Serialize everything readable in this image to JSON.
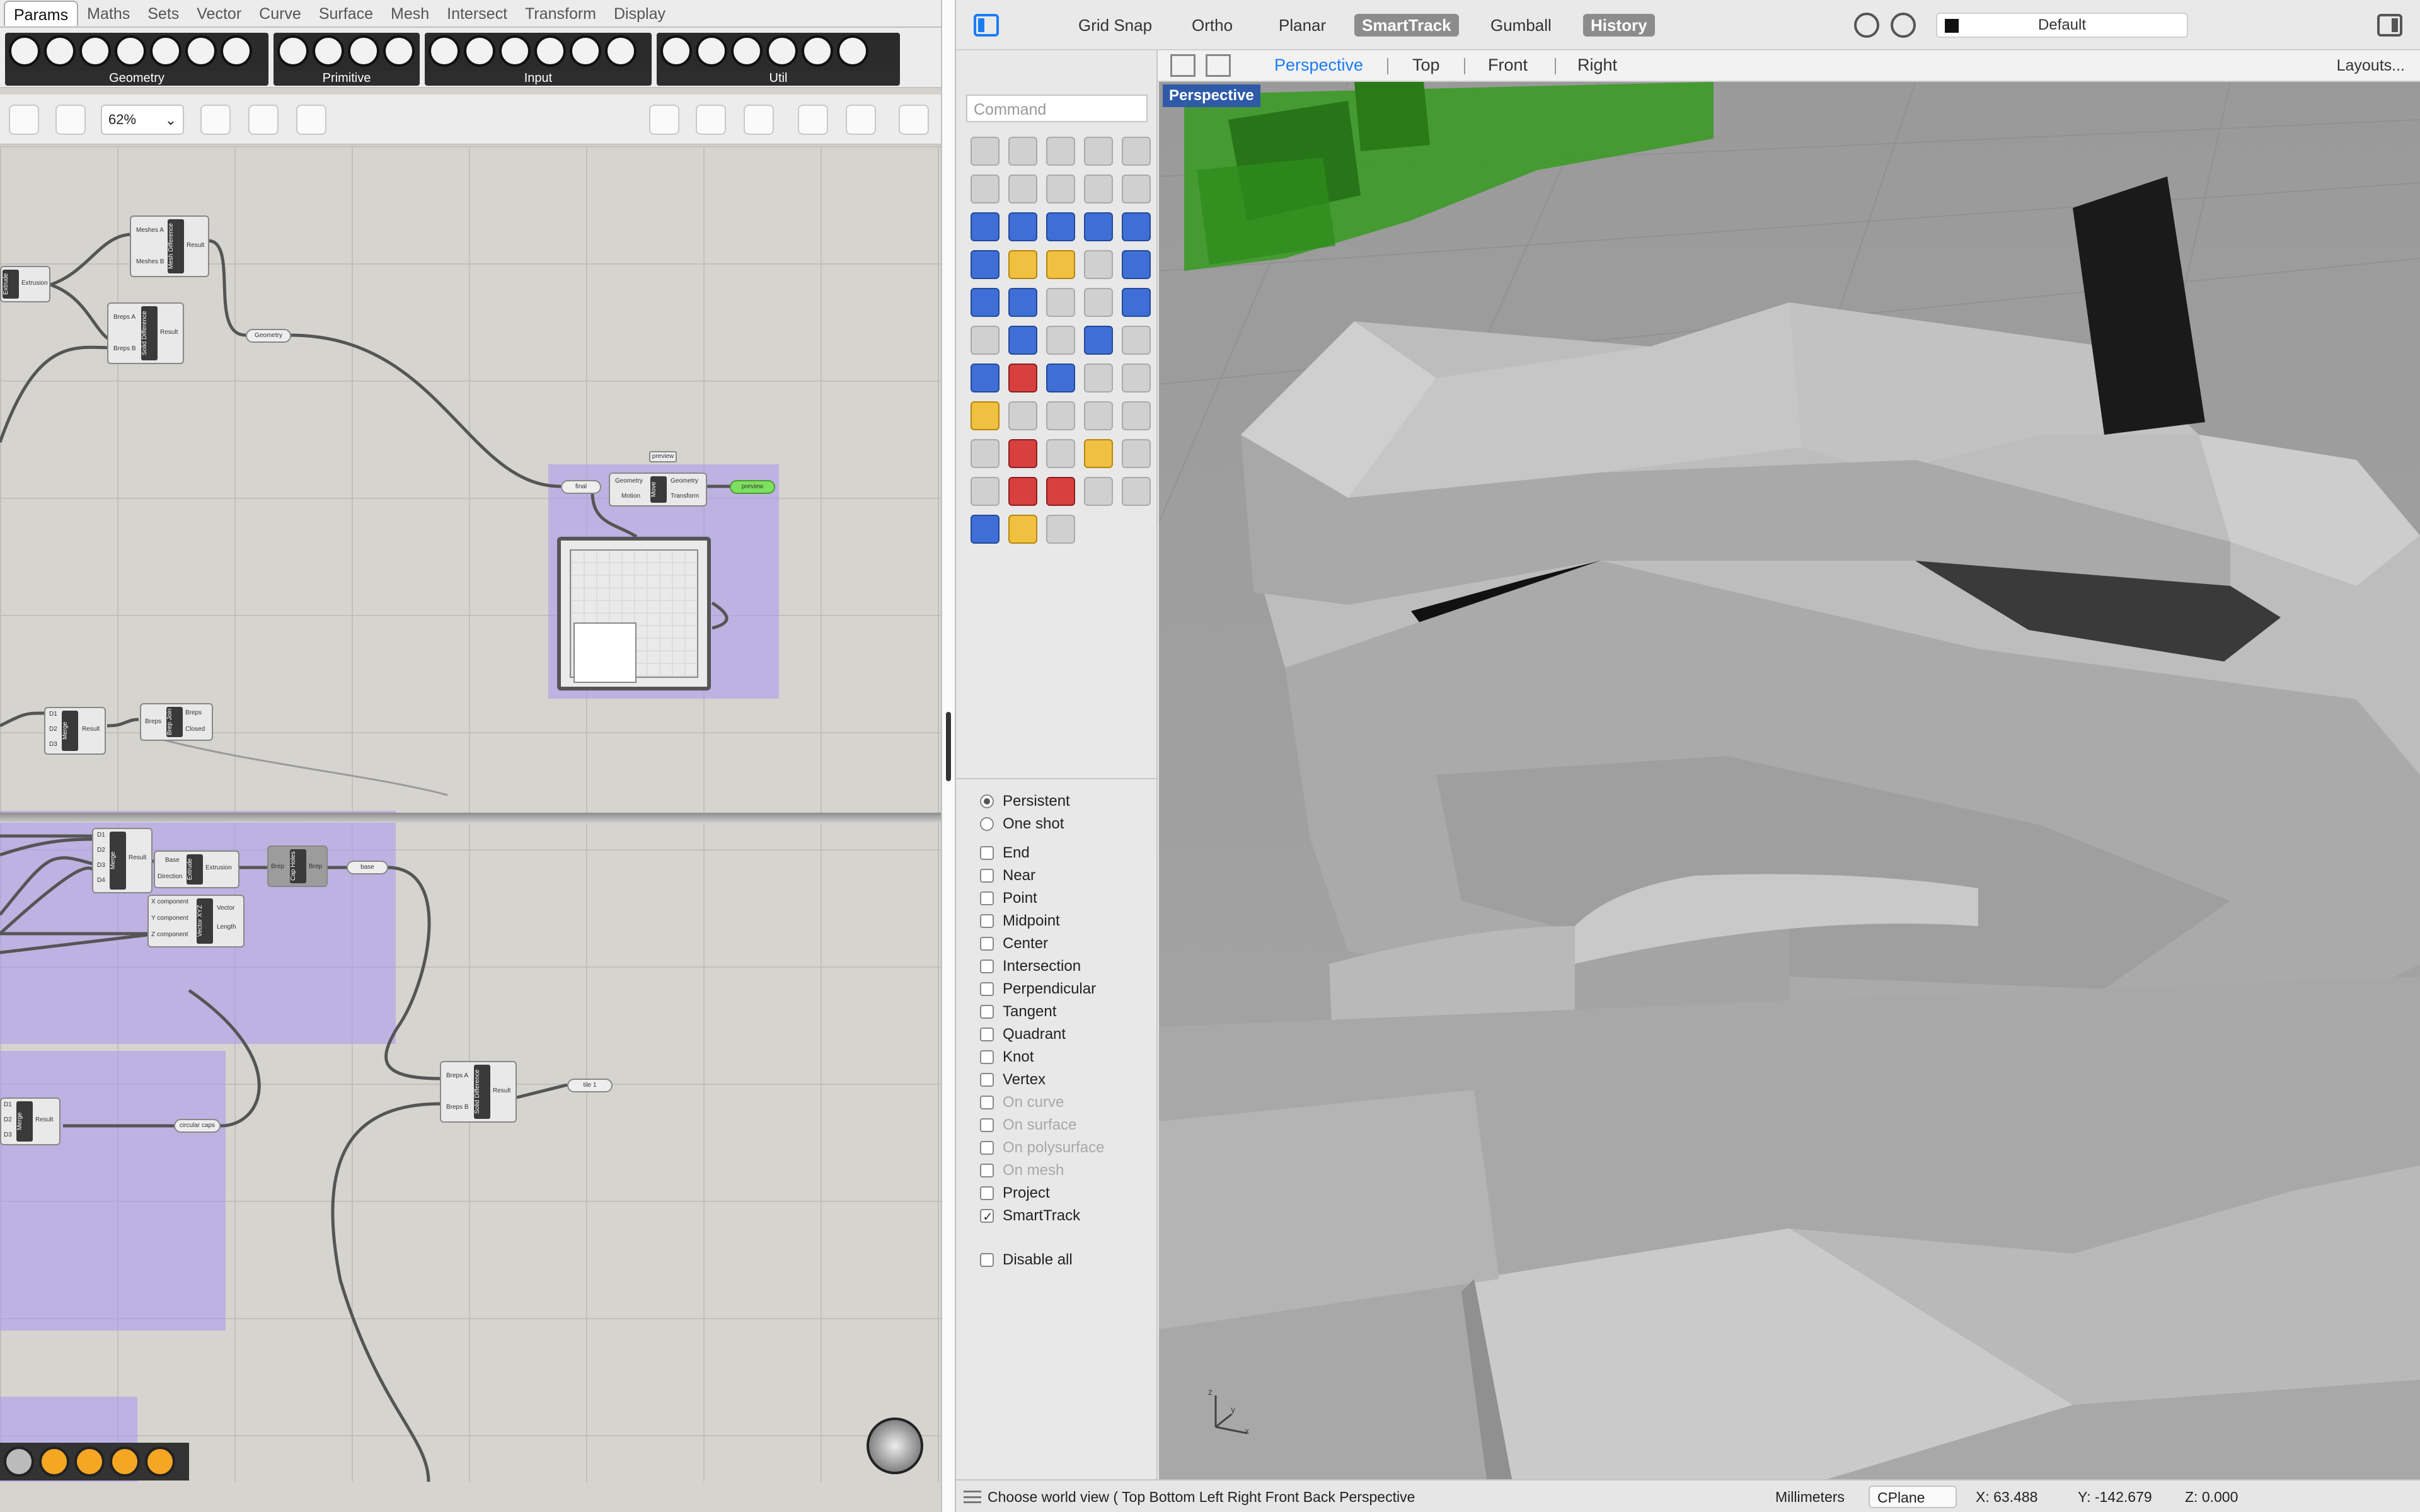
{
  "grasshopper": {
    "tabs": [
      "Params",
      "Maths",
      "Sets",
      "Vector",
      "Curve",
      "Surface",
      "Mesh",
      "Intersect",
      "Transform",
      "Display"
    ],
    "active_tab": "Params",
    "ribbon_groups": [
      "Geometry",
      "Primitive",
      "Input",
      "Util"
    ],
    "zoom": "62%",
    "nodes": {
      "mesh_difference": {
        "title": "Mesh Difference",
        "in1": "Meshes A",
        "in2": "Meshes B",
        "out": "Result"
      },
      "solid_difference_top": {
        "title": "Solid Difference",
        "in1": "Breps A",
        "in2": "Breps B",
        "out": "Result"
      },
      "extrude_left": {
        "title": "Extrude",
        "out": "Extrusion"
      },
      "geometry_param": "Geometry",
      "preview_label": "preview",
      "final_param": "final",
      "move": {
        "title": "Move",
        "in1": "Geometry",
        "in2": "Motion",
        "out1": "Geometry",
        "out2": "Transform"
      },
      "preview_param": "preview",
      "merge_top": {
        "title": "Merge",
        "in": [
          "D1",
          "D2",
          "D3"
        ],
        "out": "Result"
      },
      "brep_join": {
        "title": "Brep Join",
        "in": "Breps",
        "out1": "Breps",
        "out2": "Closed"
      },
      "merge_mid": {
        "title": "Merge",
        "in": [
          "D1",
          "D2",
          "D3",
          "D4"
        ],
        "out": "Result"
      },
      "extrude_mid": {
        "title": "Extrude",
        "in1": "Base",
        "in2": "Direction",
        "out": "Extrusion"
      },
      "cap_holes": {
        "title": "Cap Holes",
        "in": "Brep",
        "out": "Brep"
      },
      "base_param": "base",
      "vector_xyz": {
        "title": "Vector XYZ",
        "in": [
          "X component",
          "Y component",
          "Z component"
        ],
        "out1": "Vector",
        "out2": "Length"
      },
      "solid_difference_bottom": {
        "title": "Solid Difference",
        "in1": "Breps A",
        "in2": "Breps B",
        "out": "Result"
      },
      "tile_param": "tile 1",
      "merge_bottom": {
        "title": "Merge",
        "in": [
          "D1",
          "D2",
          "D3"
        ],
        "out": "Result"
      },
      "circular_caps_param": "circular caps"
    }
  },
  "rhino": {
    "modes": [
      {
        "label": "Grid Snap",
        "on": false
      },
      {
        "label": "Ortho",
        "on": false
      },
      {
        "label": "Planar",
        "on": false
      },
      {
        "label": "SmartTrack",
        "on": true
      },
      {
        "label": "Gumball",
        "on": false
      },
      {
        "label": "History",
        "on": true
      }
    ],
    "layer": "Default",
    "view_tabs": [
      "Perspective",
      "Top",
      "Front",
      "Right"
    ],
    "active_view": "Perspective",
    "layouts_label": "Layouts...",
    "command_placeholder": "Command",
    "viewport_label": "Perspective",
    "snap_mode": [
      {
        "label": "Persistent",
        "checked": true
      },
      {
        "label": "One shot",
        "checked": false
      }
    ],
    "osnaps": [
      {
        "label": "End",
        "checked": false,
        "enabled": true
      },
      {
        "label": "Near",
        "checked": false,
        "enabled": true
      },
      {
        "label": "Point",
        "checked": false,
        "enabled": true
      },
      {
        "label": "Midpoint",
        "checked": false,
        "enabled": true
      },
      {
        "label": "Center",
        "checked": false,
        "enabled": true
      },
      {
        "label": "Intersection",
        "checked": false,
        "enabled": true
      },
      {
        "label": "Perpendicular",
        "checked": false,
        "enabled": true
      },
      {
        "label": "Tangent",
        "checked": false,
        "enabled": true
      },
      {
        "label": "Quadrant",
        "checked": false,
        "enabled": true
      },
      {
        "label": "Knot",
        "checked": false,
        "enabled": true
      },
      {
        "label": "Vertex",
        "checked": false,
        "enabled": true
      },
      {
        "label": "On curve",
        "checked": false,
        "enabled": false
      },
      {
        "label": "On surface",
        "checked": false,
        "enabled": false
      },
      {
        "label": "On polysurface",
        "checked": false,
        "enabled": false
      },
      {
        "label": "On mesh",
        "checked": false,
        "enabled": false
      },
      {
        "label": "Project",
        "checked": false,
        "enabled": true
      },
      {
        "label": "SmartTrack",
        "checked": true,
        "enabled": true
      }
    ],
    "disable_all": "Disable all",
    "status": {
      "message": "Choose world view ( Top Bottom Left Right Front Back Perspective",
      "units": "Millimeters",
      "cplane": "CPlane",
      "x": "X: 63.488",
      "y": "Y: -142.679",
      "z": "Z: 0.000"
    },
    "axis_labels": {
      "z": "z",
      "y": "y",
      "x": "x"
    }
  },
  "colors": {
    "accent": "#1a7cf5",
    "group": "#aa96f0",
    "viewport_label": "#2e5aa8",
    "green_param": "#7de05f"
  }
}
